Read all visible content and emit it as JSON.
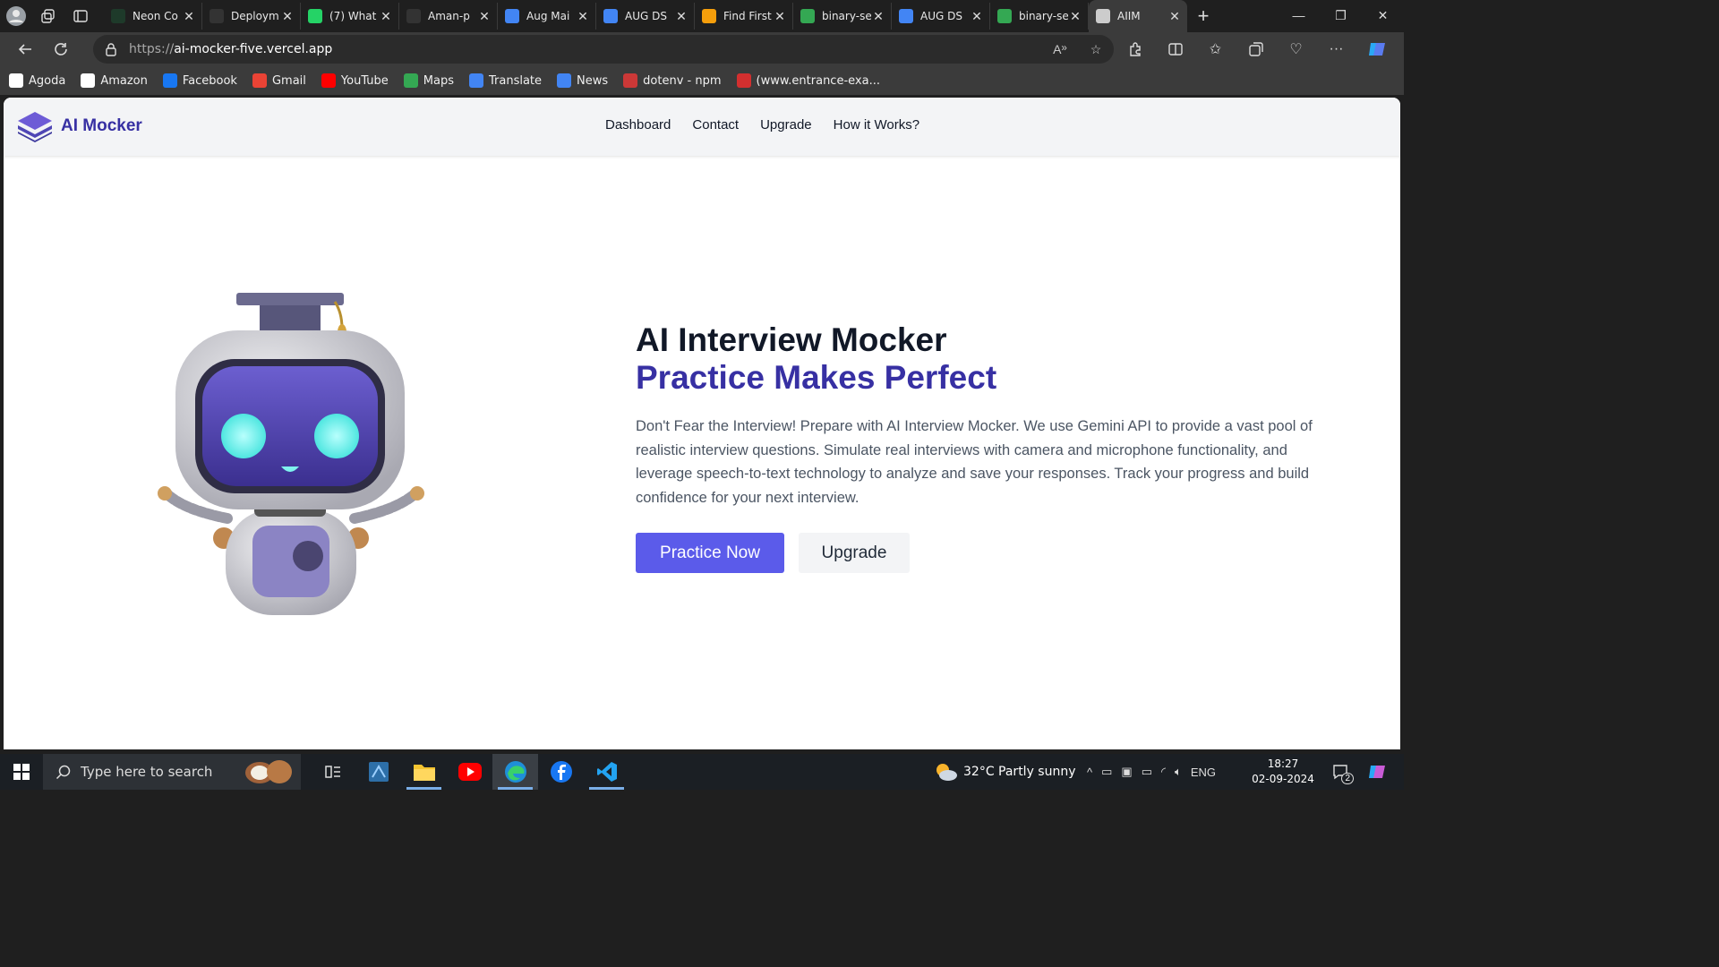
{
  "browser": {
    "tabs": [
      {
        "title": "Neon Co",
        "icon": "neon-icon",
        "color": "#1e3a2a"
      },
      {
        "title": "Deploym",
        "icon": "github-icon",
        "color": "#333"
      },
      {
        "title": "(7) What",
        "icon": "whatsapp-icon",
        "color": "#25d366"
      },
      {
        "title": "Aman-p",
        "icon": "github-icon",
        "color": "#333"
      },
      {
        "title": "Aug Mai",
        "icon": "docs-icon",
        "color": "#4285f4"
      },
      {
        "title": "AUG DS",
        "icon": "docs-icon",
        "color": "#4285f4"
      },
      {
        "title": "Find First",
        "icon": "find-icon",
        "color": "#f59e0b"
      },
      {
        "title": "binary-se",
        "icon": "drive-icon",
        "color": "#34a853"
      },
      {
        "title": "AUG DS",
        "icon": "docs-icon",
        "color": "#4285f4"
      },
      {
        "title": "binary-se",
        "icon": "drive-icon",
        "color": "#34a853"
      },
      {
        "title": "AIIM",
        "icon": "page-icon",
        "color": "#ccc",
        "active": true
      }
    ],
    "url_protocol": "https://",
    "url_host": "ai-mocker-five.vercel.app",
    "bookmarks": [
      {
        "label": "Agoda",
        "icon": "agoda-icon",
        "color": "#fff"
      },
      {
        "label": "Amazon",
        "icon": "amazon-icon",
        "color": "#fff"
      },
      {
        "label": "Facebook",
        "icon": "facebook-icon",
        "color": "#1877f2"
      },
      {
        "label": "Gmail",
        "icon": "gmail-icon",
        "color": "#ea4335"
      },
      {
        "label": "YouTube",
        "icon": "youtube-icon",
        "color": "#ff0000"
      },
      {
        "label": "Maps",
        "icon": "maps-icon",
        "color": "#34a853"
      },
      {
        "label": "Translate",
        "icon": "translate-icon",
        "color": "#4285f4"
      },
      {
        "label": "News",
        "icon": "news-icon",
        "color": "#4285f4"
      },
      {
        "label": "dotenv - npm",
        "icon": "npm-icon",
        "color": "#cb3837"
      },
      {
        "label": "(www.entrance-exa...",
        "icon": "pdf-icon",
        "color": "#d32f2f"
      }
    ]
  },
  "site": {
    "brand": "AI Mocker",
    "nav": [
      "Dashboard",
      "Contact",
      "Upgrade",
      "How it Works?"
    ],
    "hero": {
      "title": "AI Interview Mocker",
      "subtitle": "Practice Makes Perfect",
      "description": "Don't Fear the Interview! Prepare with AI Interview Mocker. We use Gemini API to provide a vast pool of realistic interview questions. Simulate real interviews with camera and microphone functionality, and leverage speech-to-text technology to analyze and save your responses. Track your progress and build confidence for your next interview.",
      "primary_button": "Practice Now",
      "secondary_button": "Upgrade"
    },
    "colors": {
      "brand": "#3730a3",
      "primary_button": "#5b5bea"
    }
  },
  "taskbar": {
    "search_placeholder": "Type here to search",
    "weather": "32°C  Partly sunny",
    "language": "ENG",
    "time": "18:27",
    "date": "02-09-2024",
    "notification_count": "2"
  }
}
